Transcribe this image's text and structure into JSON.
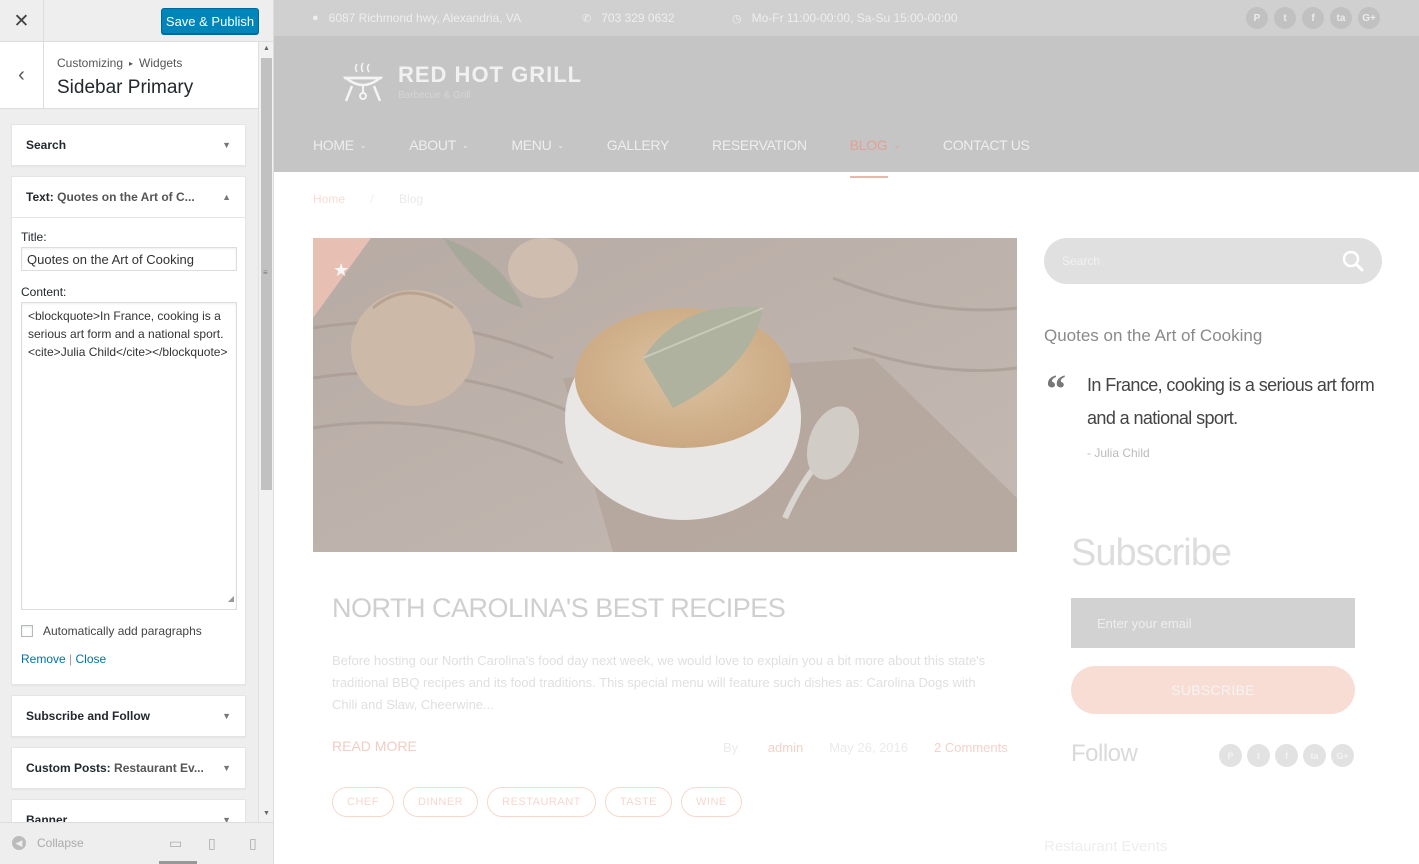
{
  "customizer": {
    "close_icon": "close-icon",
    "publish_label": "Save & Publish",
    "breadcrumb": {
      "part1": "Customizing",
      "part2": "Widgets"
    },
    "section_title": "Sidebar Primary",
    "widgets": {
      "search": {
        "label": "Search"
      },
      "text": {
        "prefix": "Text:",
        "label": "Quotes on the Art of C...",
        "title_label": "Title:",
        "title_value": "Quotes on the Art of Cooking",
        "content_label": "Content:",
        "content_value": "<blockquote>In France, cooking is a serious art form and a national sport. <cite>Julia Child</cite></blockquote>",
        "auto_p_label": "Automatically add paragraphs",
        "auto_p_checked": false,
        "remove_label": "Remove",
        "sep": "|",
        "close_label": "Close"
      },
      "subscribe": {
        "label": "Subscribe and Follow"
      },
      "custom_posts": {
        "prefix": "Custom Posts:",
        "label": "Restaurant Ev..."
      },
      "banner": {
        "label": "Banner"
      }
    },
    "footer": {
      "collapse_label": "Collapse"
    }
  },
  "preview": {
    "topbar": {
      "address": "6087 Richmond hwy, Alexandria, VA",
      "phone": "703 329 0632",
      "hours": "Mo-Fr 11:00-00:00, Sa-Su 15:00-00:00",
      "social": [
        "P",
        "t",
        "f",
        "ta",
        "G+"
      ]
    },
    "site": {
      "name": "RED HOT GRILL",
      "tagline": "Barbecue & Grill"
    },
    "nav": [
      {
        "label": "HOME",
        "dropdown": true
      },
      {
        "label": "ABOUT",
        "dropdown": true
      },
      {
        "label": "MENU",
        "dropdown": true
      },
      {
        "label": "GALLERY",
        "dropdown": false
      },
      {
        "label": "RESERVATION",
        "dropdown": false
      },
      {
        "label": "BLOG",
        "dropdown": true,
        "active": true
      },
      {
        "label": "CONTACT US",
        "dropdown": false
      }
    ],
    "breadcrumb": {
      "home": "Home",
      "sep": "/",
      "current": "Blog"
    },
    "post": {
      "title": "NORTH CAROLINA'S BEST RECIPES",
      "excerpt": "Before hosting our North Carolina's food day next week, we would love to explain you a bit more about this state's traditional BBQ recipes and its food traditions. This special menu will feature such dishes as: Carolina Dogs with Chili and Slaw, Cheerwine...",
      "read_more": "READ MORE",
      "by": "By",
      "author": "admin",
      "date": "May 26, 2016",
      "comments": "2 Comments",
      "tags": [
        "CHEF",
        "DINNER",
        "RESTAURANT",
        "TASTE",
        "WINE"
      ]
    },
    "sidebar": {
      "search_placeholder": "Search",
      "quote_title": "Quotes on the Art of Cooking",
      "quote_mark": "“",
      "quote_text": "In France, cooking is a serious art form and a national sport.",
      "quote_cite": "- Julia Child",
      "subscribe_title": "Subscribe",
      "email_placeholder": "Enter your email",
      "subscribe_btn": "SUBSCRIBE",
      "follow_title": "Follow",
      "follow_social": [
        "P",
        "t",
        "f",
        "ta",
        "G+"
      ],
      "events_title": "Restaurant Events"
    }
  },
  "colors": {
    "accent": "#0085ba",
    "brand_red": "#e0a294"
  }
}
